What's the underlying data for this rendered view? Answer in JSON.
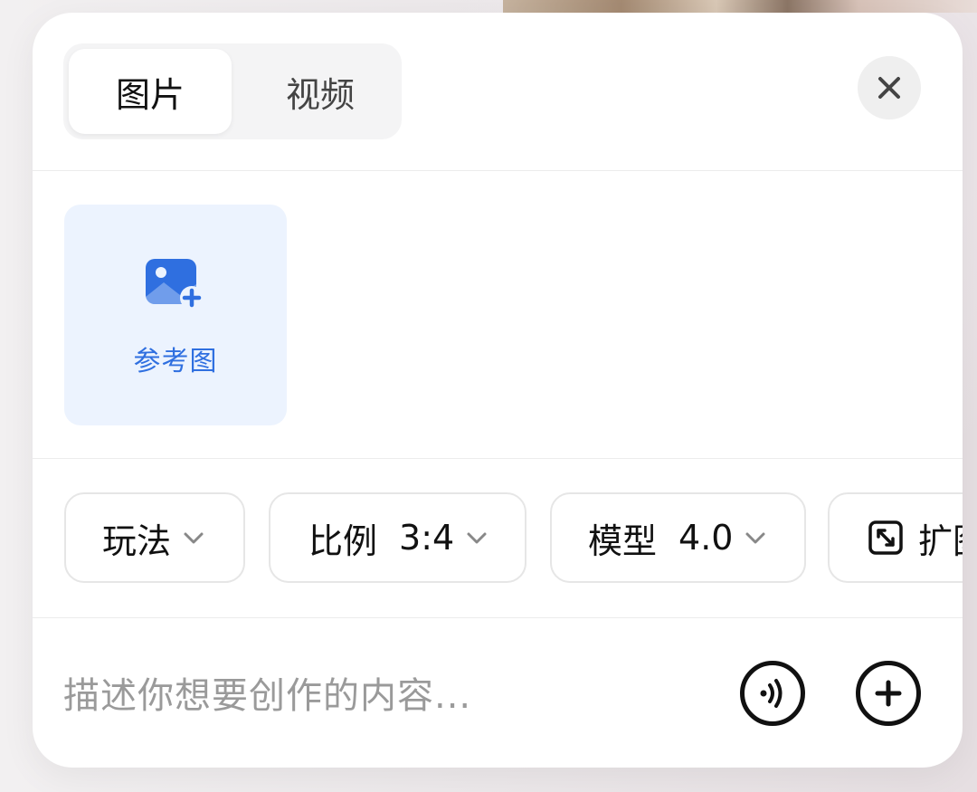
{
  "tabs": [
    {
      "label": "图片",
      "active": true
    },
    {
      "label": "视频",
      "active": false
    }
  ],
  "close_icon": "close-icon",
  "reference": {
    "label": "参考图",
    "icon": "image-add-icon",
    "color": "#2f6fe0"
  },
  "options": {
    "play": {
      "label": "玩法"
    },
    "ratio": {
      "label": "比例",
      "value": "3:4"
    },
    "model": {
      "label": "模型",
      "value": "4.0"
    },
    "expand": {
      "label": "扩图",
      "icon": "expand-icon"
    }
  },
  "prompt": {
    "placeholder": "描述你想要创作的内容..."
  },
  "actions": {
    "voice_icon": "voice-icon",
    "add_icon": "add-icon"
  }
}
